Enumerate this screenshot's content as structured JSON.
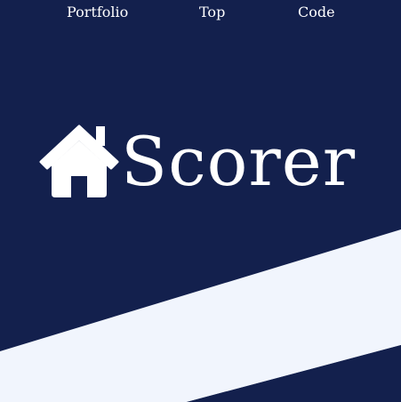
{
  "nav": {
    "items": [
      {
        "label": "Portfolio"
      },
      {
        "label": "Top"
      },
      {
        "label": "Code"
      }
    ]
  },
  "hero": {
    "brand": "Scorer",
    "icon": "house-icon"
  },
  "colors": {
    "background": "#13204d",
    "band": "#f1f5fd",
    "text": "#ffffff"
  }
}
